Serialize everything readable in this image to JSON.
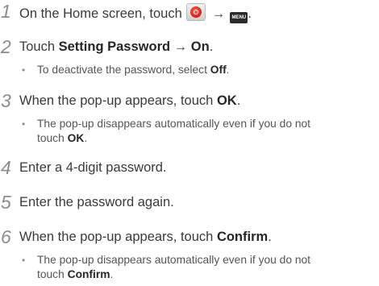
{
  "steps": [
    {
      "number": "1",
      "pre": "On the Home screen, touch",
      "arrow": "→",
      "menu_icon_text": "MENU",
      "post": ".",
      "icons": [
        "messaging-app-icon",
        "menu-key-icon"
      ]
    },
    {
      "number": "2",
      "pre": "Touch",
      "bold1": "Setting Password",
      "arrow": "→",
      "bold2": "On",
      "post": ".",
      "sub": {
        "pre": "To deactivate the password, select",
        "bold": "Off",
        "post": "."
      }
    },
    {
      "number": "3",
      "pre": "When the pop-up appears, touch",
      "bold": "OK",
      "post": ".",
      "sub": {
        "line1": "The pop-up disappears automatically even if you do not",
        "pre2": "touch",
        "bold": "OK",
        "post": "."
      }
    },
    {
      "number": "4",
      "text": "Enter a 4-digit password."
    },
    {
      "number": "5",
      "text": "Enter the password again."
    },
    {
      "number": "6",
      "pre": "When the pop-up appears, touch",
      "bold": "Confirm",
      "post": ".",
      "sub": {
        "line1": "The pop-up disappears automatically even if you do not",
        "pre2": "touch",
        "bold": "Confirm",
        "post": "."
      }
    }
  ],
  "bullet": "•"
}
